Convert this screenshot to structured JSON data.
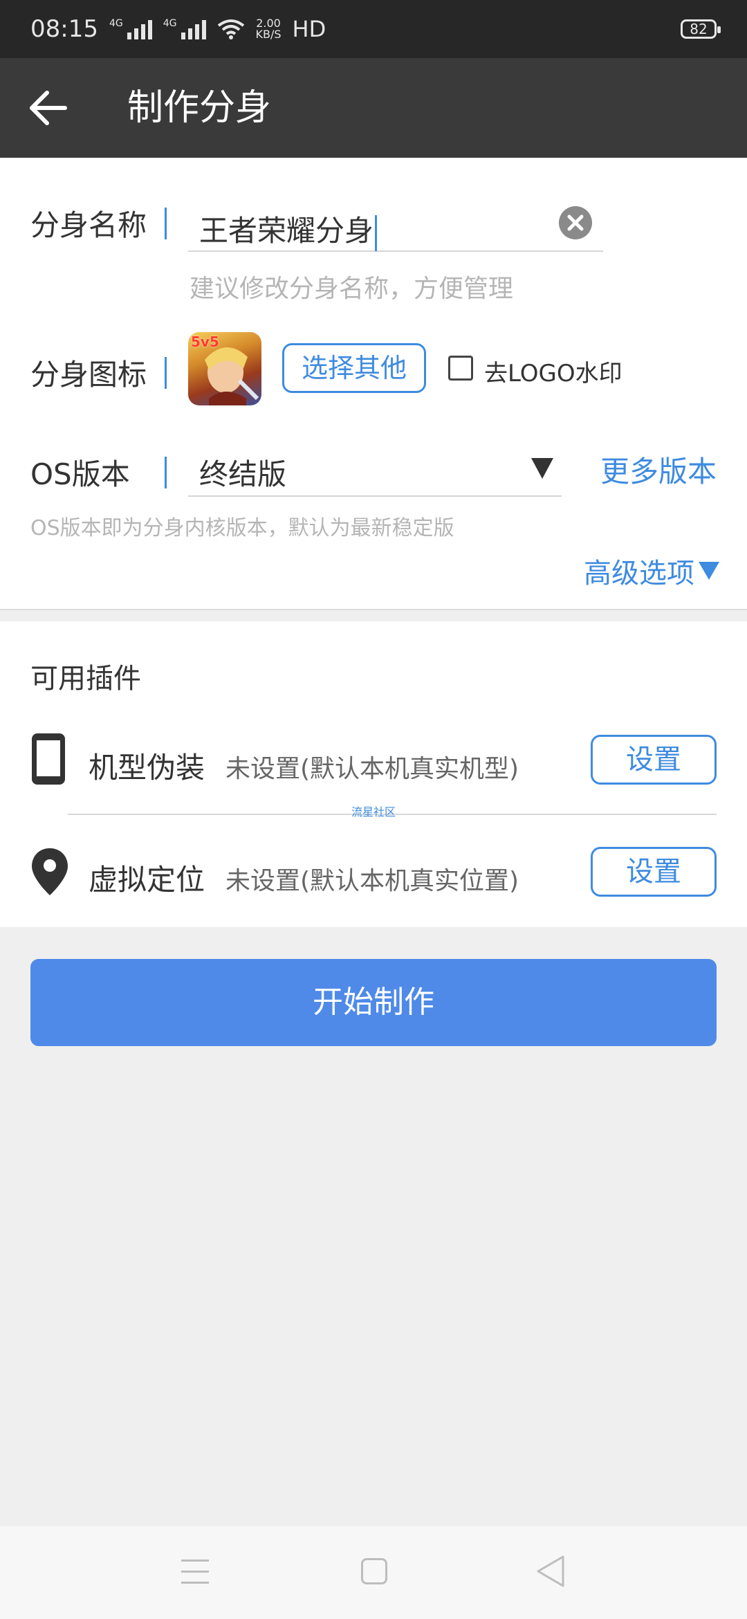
{
  "status_bar": {
    "time": "08:15",
    "signal1_label": "4G",
    "signal2_label": "4G",
    "net_speed_value": "2.00",
    "net_speed_unit": "KB/S",
    "hd_label": "HD",
    "battery": "82"
  },
  "header": {
    "title": "制作分身"
  },
  "form": {
    "name_label": "分身名称",
    "name_value": "王者荣耀分身",
    "name_hint": "建议修改分身名称，方便管理",
    "icon_label": "分身图标",
    "icon_tag": "5v5",
    "choose_other_label": "选择其他",
    "remove_logo_label": "去LOGO水印",
    "remove_logo_checked": false,
    "os_label": "OS版本",
    "os_value": "终结版",
    "more_versions_label": "更多版本",
    "os_hint": "OS版本即为分身内核版本，默认为最新稳定版",
    "advanced_label": "高级选项"
  },
  "plugins": {
    "title": "可用插件",
    "items": [
      {
        "name": "机型伪装",
        "status": "未设置(默认本机真实机型)",
        "button": "设置",
        "icon": "phone-icon"
      },
      {
        "name": "虚拟定位",
        "status": "未设置(默认本机真实位置)",
        "button": "设置",
        "icon": "location-pin-icon"
      }
    ],
    "watermark": "流星社区"
  },
  "actions": {
    "start_label": "开始制作"
  },
  "colors": {
    "accent": "#3e8be0",
    "primary_button": "#4f8ae8",
    "title_bar": "#3a3a3a",
    "status_bar": "#272727"
  }
}
